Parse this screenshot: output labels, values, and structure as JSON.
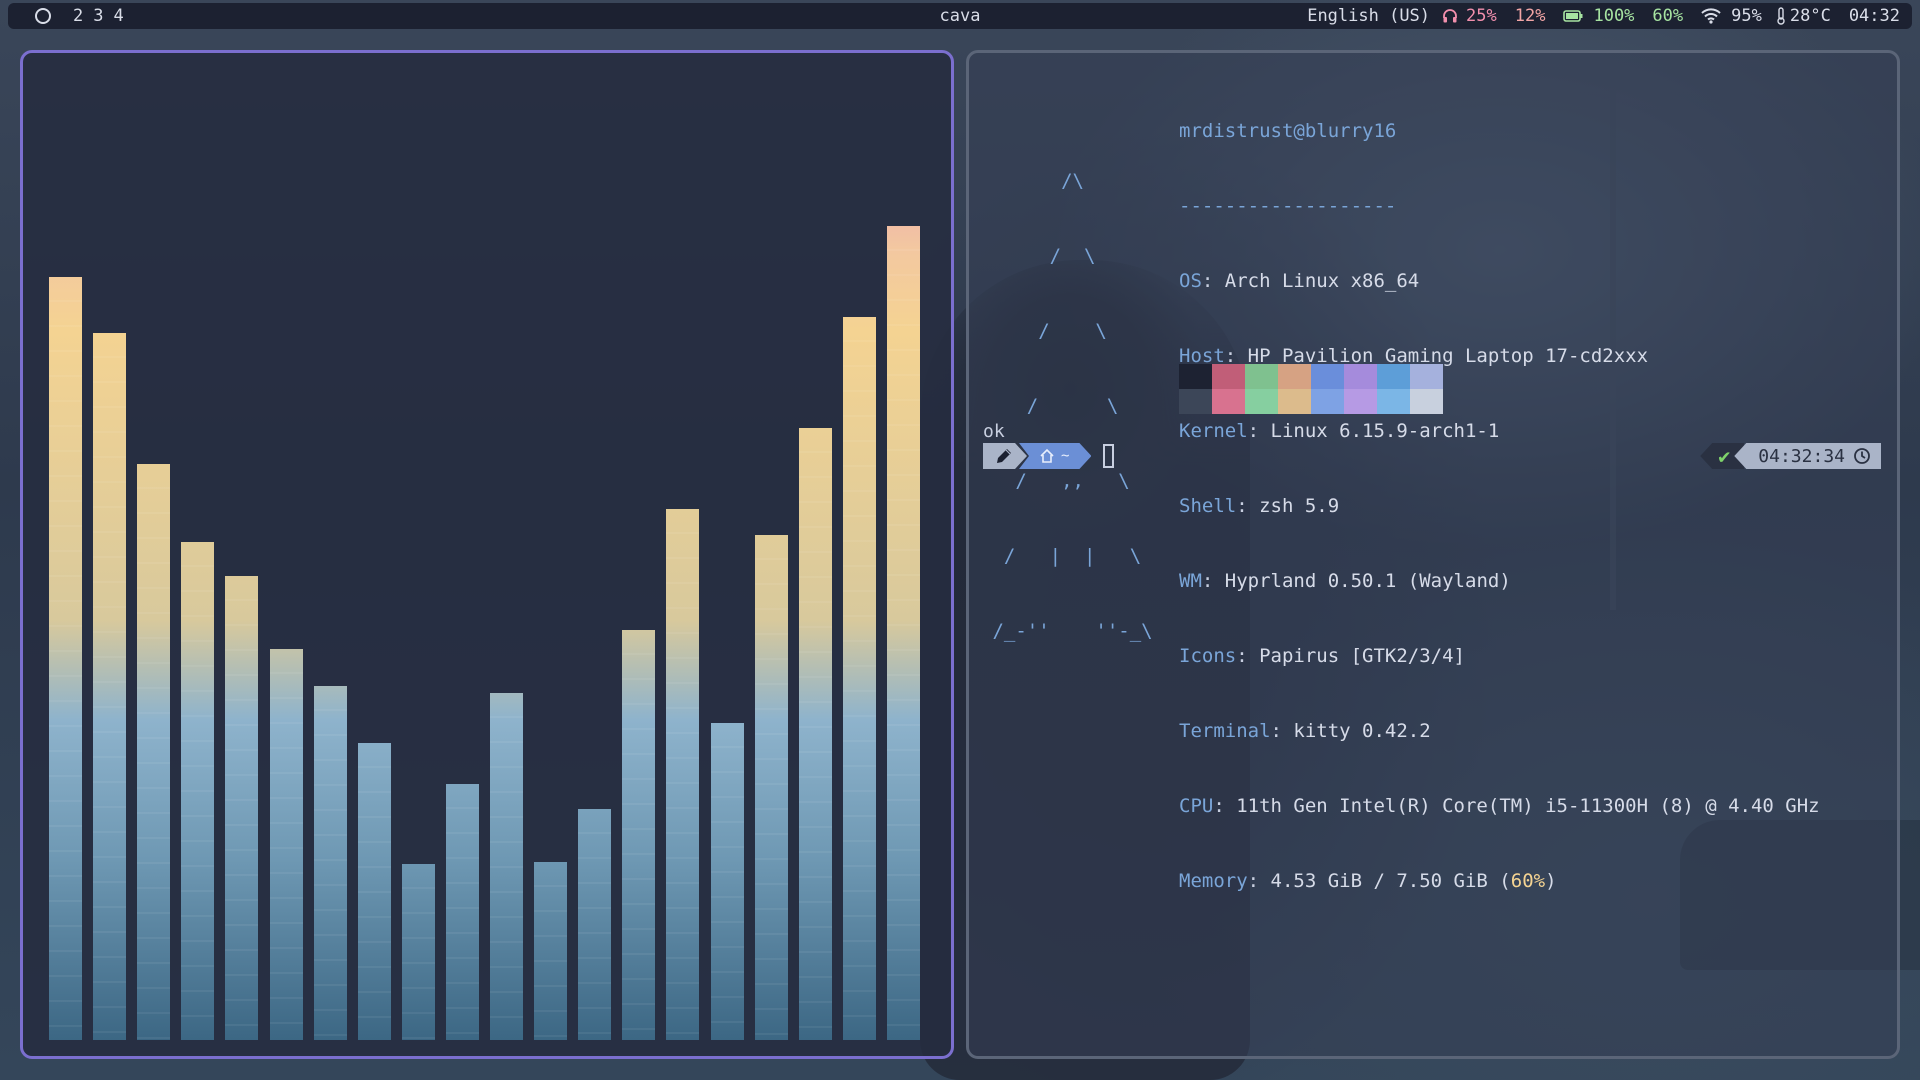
{
  "topbar": {
    "workspaces": [
      "2",
      "3",
      "4"
    ],
    "window_title": "cava",
    "language": "English (US)",
    "volume": "25%",
    "brightness": "12%",
    "battery": "100%",
    "battery_extra": "60%",
    "wifi": "95%",
    "temperature": "28°C",
    "clock": "04:32"
  },
  "cava": {
    "bar_levels": [
      0.848,
      0.785,
      0.64,
      0.553,
      0.515,
      0.434,
      0.393,
      0.33,
      0.195,
      0.284,
      0.385,
      0.198,
      0.257,
      0.456,
      0.59,
      0.352,
      0.561,
      0.68,
      0.803,
      0.904
    ]
  },
  "terminal": {
    "user_host": "mrdistrust@blurry16",
    "separator": "-------------------",
    "logo_lines": [
      "       /\\",
      "      /  \\",
      "     /    \\",
      "    /      \\",
      "   /   ,,   \\",
      "  /   |  |   \\",
      " /_-''    ''-_\\"
    ],
    "info": [
      {
        "key": "OS",
        "value": "Arch Linux x86_64"
      },
      {
        "key": "Host",
        "value": "HP Pavilion Gaming Laptop 17-cd2xxx"
      },
      {
        "key": "Kernel",
        "value": "Linux 6.15.9-arch1-1"
      },
      {
        "key": "Shell",
        "value": "zsh 5.9"
      },
      {
        "key": "WM",
        "value": "Hyprland 0.50.1 (Wayland)"
      },
      {
        "key": "Icons",
        "value": "Papirus [GTK2/3/4]"
      },
      {
        "key": "Terminal",
        "value": "kitty 0.42.2"
      },
      {
        "key": "CPU",
        "value": "11th Gen Intel(R) Core(TM) i5-11300H (8) @ 4.40 GHz"
      }
    ],
    "memory_key": "Memory",
    "memory_value": "4.53 GiB / 7.50 GiB (",
    "memory_pct": "60%",
    "memory_close": ")",
    "palette_top": [
      "#1d2232",
      "#c15e78",
      "#7fc18f",
      "#d6a283",
      "#6a8edb",
      "#a58bdc",
      "#5d9ed8",
      "#a5b1dd"
    ],
    "palette_bottom": [
      "#3c4658",
      "#d8728f",
      "#86cfa0",
      "#dcbb8c",
      "#7ea2e4",
      "#b69ae4",
      "#7bb6e6",
      "#c8d0de"
    ],
    "last_output": "ok",
    "prompt_dir": "~",
    "rprompt_time": "04:32:34"
  },
  "colors": {
    "accent": "#7b6fcf",
    "bar_bg": "#1c2131"
  }
}
